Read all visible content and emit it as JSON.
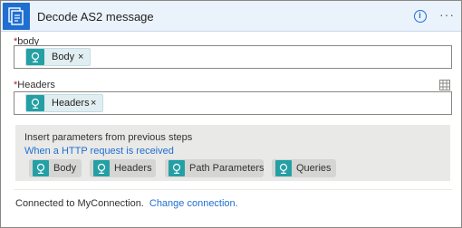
{
  "header": {
    "title": "Decode AS2 message",
    "info_icon": "info-icon",
    "more_icon": "ellipsis-icon",
    "more_glyph": "···",
    "brand_color": "#1f6fd1"
  },
  "fields": {
    "body": {
      "required_mark": "*",
      "label": "body",
      "token": {
        "label": "Body",
        "remove": "×",
        "icon": "http-request-icon"
      }
    },
    "headers": {
      "required_mark": "*",
      "label": "Headers",
      "token": {
        "label": "Headers",
        "remove": "×",
        "icon": "http-request-icon"
      },
      "side_icon": "table-toggle-icon"
    }
  },
  "dynamic_content": {
    "heading": "Insert parameters from previous steps",
    "source": "When a HTTP request is received",
    "chips": [
      {
        "label": "Body",
        "icon": "http-request-icon"
      },
      {
        "label": "Headers",
        "icon": "http-request-icon"
      },
      {
        "label": "Path Parameters",
        "icon": "http-request-icon"
      },
      {
        "label": "Queries",
        "icon": "http-request-icon"
      }
    ],
    "token_color": "#24a0a5"
  },
  "footer": {
    "connected_text": "Connected to MyConnection.",
    "change_link": "Change connection."
  }
}
